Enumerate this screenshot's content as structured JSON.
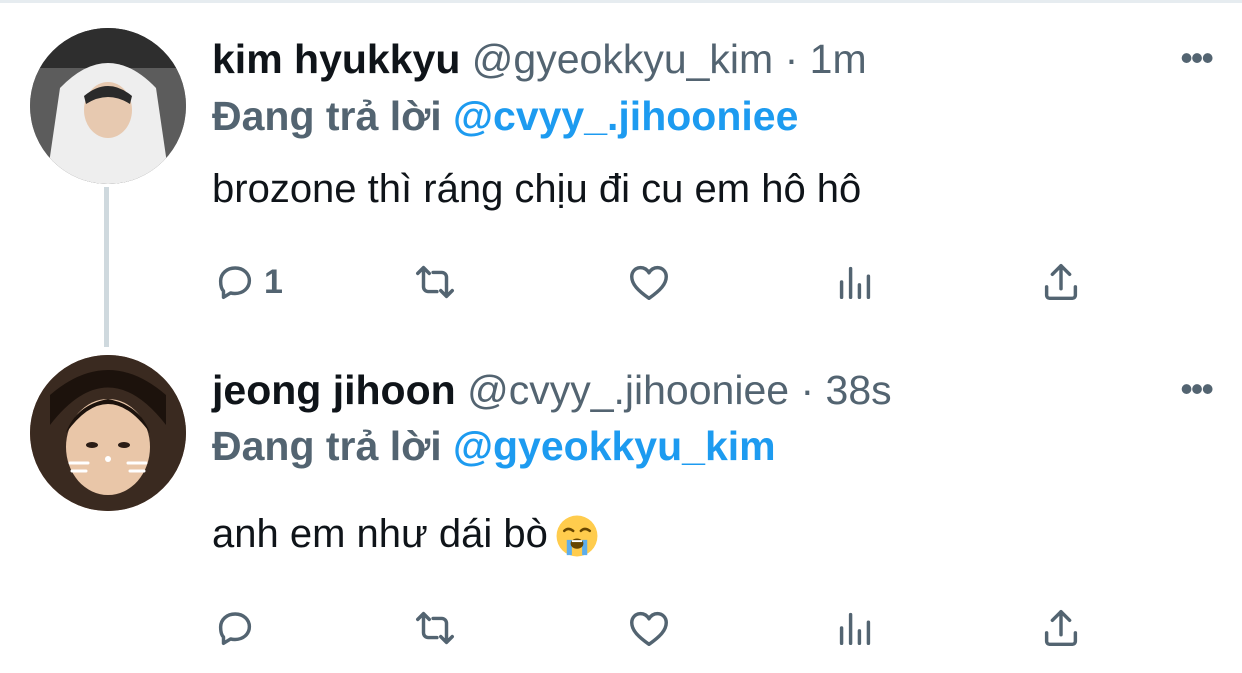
{
  "tweets": [
    {
      "name": "kim hyukkyu",
      "handle": "@gyeokkyu_kim",
      "separator": "·",
      "time": "1m",
      "reply_prefix": "Đang trả lời",
      "reply_to": "@cvyy_.jihooniee",
      "text": "brozone thì ráng chịu đi cu em hô hô",
      "reply_count": "1",
      "more": "•••"
    },
    {
      "name": "jeong jihoon",
      "handle": "@cvyy_.jihooniee",
      "separator": "·",
      "time": "38s",
      "reply_prefix": "Đang trả lời",
      "reply_to": "@gyeokkyu_kim",
      "text": "anh em như dái bò",
      "emoji": "loudly-crying-face",
      "reply_count": "",
      "more": "•••"
    }
  ],
  "icons": [
    "reply-icon",
    "retweet-icon",
    "like-icon",
    "analytics-icon",
    "share-icon",
    "more-icon"
  ],
  "colors": {
    "link": "#1d9bf0",
    "secondary": "#536471",
    "text": "#0f1419",
    "thread_line": "#cfd9de"
  }
}
